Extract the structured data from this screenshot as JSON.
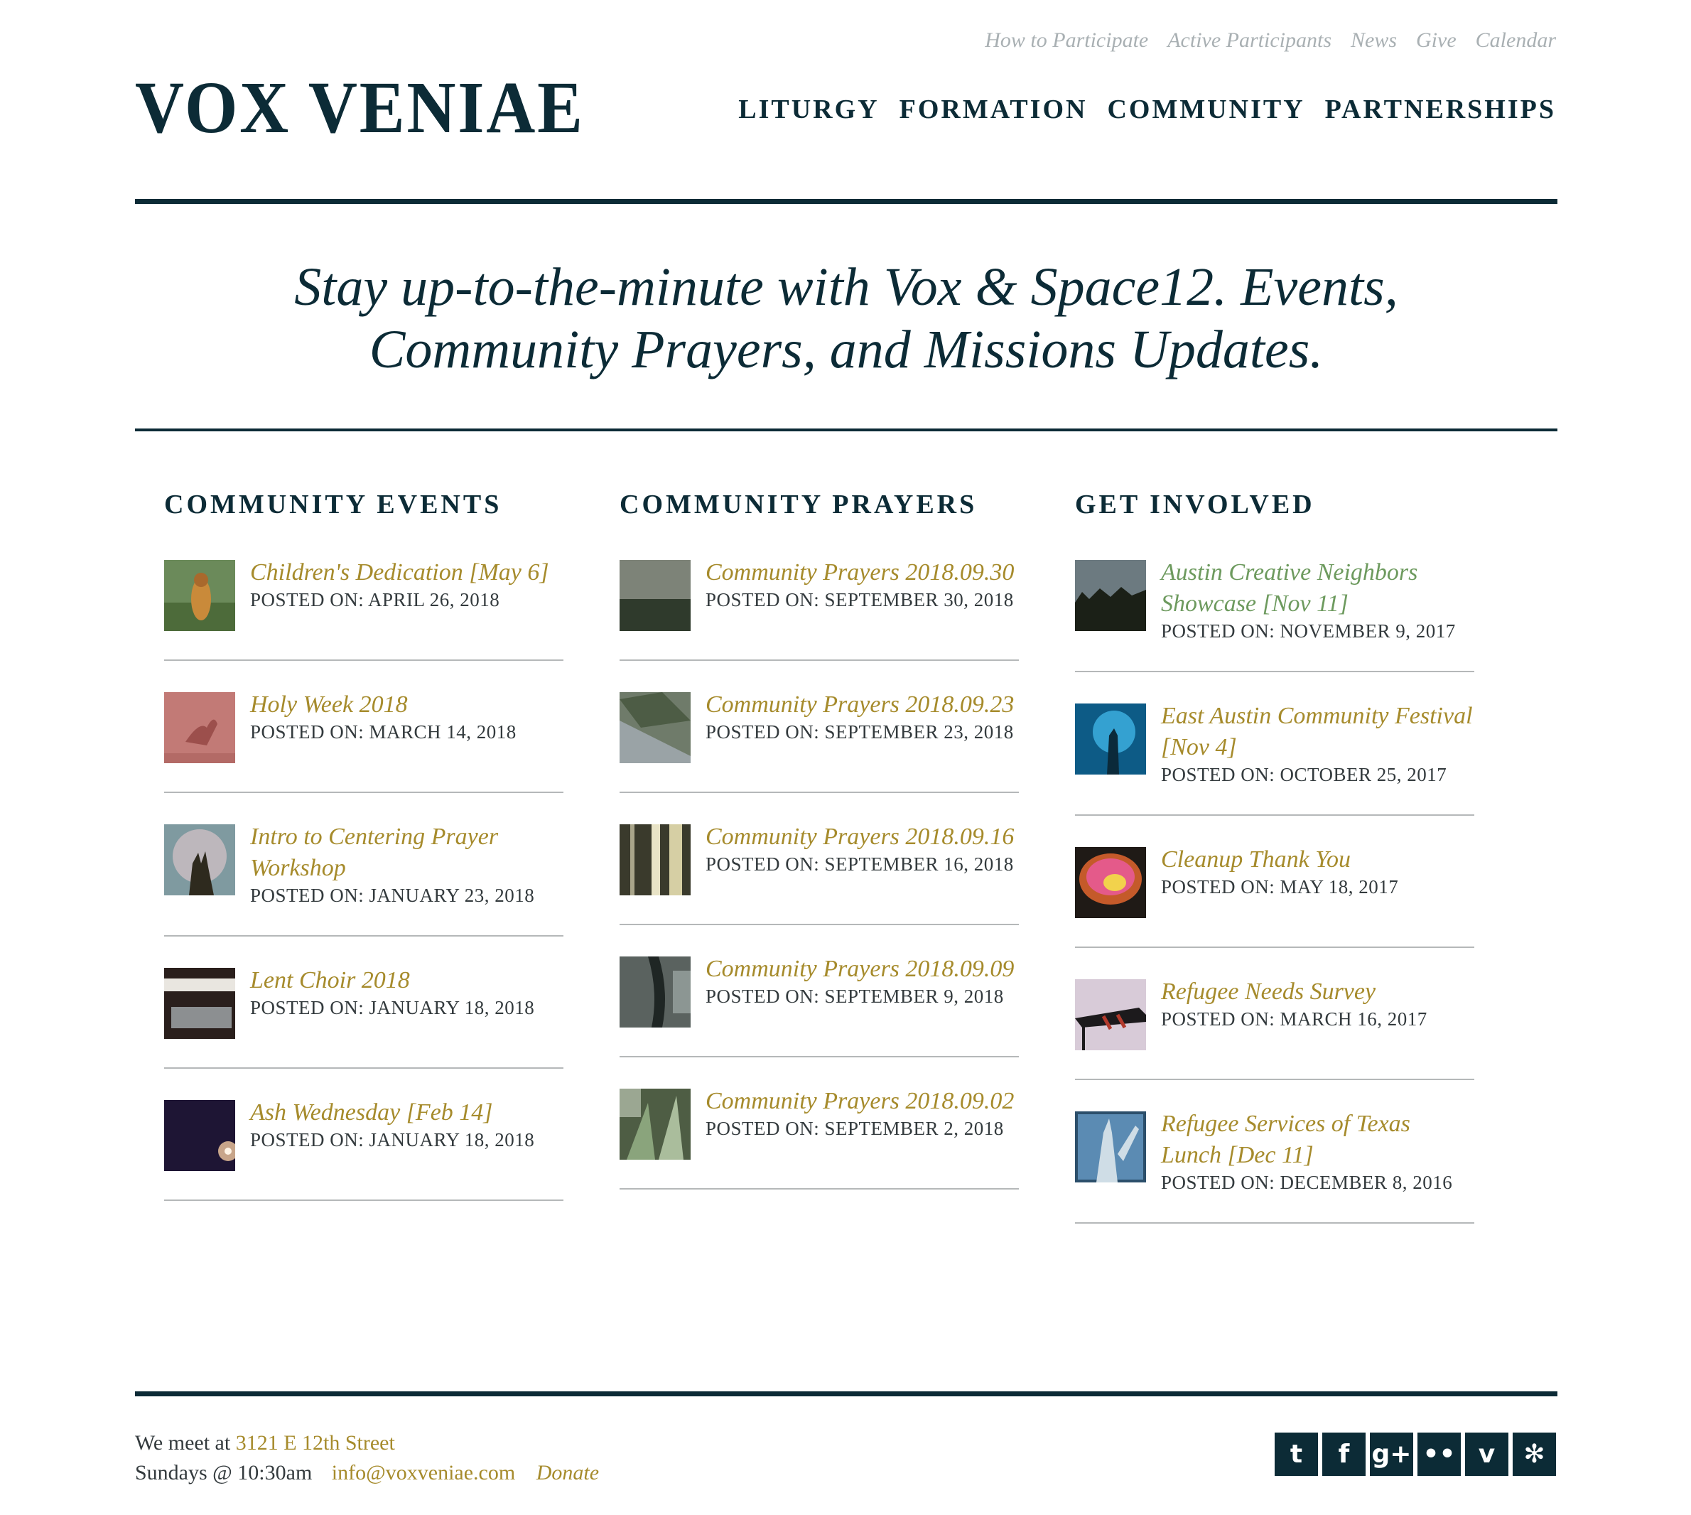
{
  "header": {
    "logo": "VOX VENIAE",
    "utility_nav": [
      "How to Participate",
      "Active Participants",
      "News",
      "Give",
      "Calendar"
    ],
    "main_nav": [
      "LITURGY",
      "FORMATION",
      "COMMUNITY",
      "PARTNERSHIPS"
    ]
  },
  "tagline": {
    "line1": "Stay up-to-the-minute with Vox & Space12. Events,",
    "line2": "Community Prayers, and Missions Updates."
  },
  "columns": [
    {
      "heading": "COMMUNITY EVENTS",
      "items": [
        {
          "title": "Children's Dedication [May 6]",
          "date": "POSTED ON: APRIL 26, 2018"
        },
        {
          "title": "Holy Week 2018",
          "date": "POSTED ON: MARCH 14, 2018"
        },
        {
          "title": "Intro to Centering Prayer Workshop",
          "date": "POSTED ON: JANUARY 23, 2018"
        },
        {
          "title": "Lent Choir 2018",
          "date": "POSTED ON: JANUARY 18, 2018"
        },
        {
          "title": "Ash Wednesday [Feb 14]",
          "date": "POSTED ON: JANUARY 18, 2018"
        }
      ]
    },
    {
      "heading": "COMMUNITY PRAYERS",
      "items": [
        {
          "title": "Community Prayers 2018.09.30",
          "date": "POSTED ON: SEPTEMBER 30, 2018"
        },
        {
          "title": "Community Prayers 2018.09.23",
          "date": "POSTED ON: SEPTEMBER 23, 2018"
        },
        {
          "title": "Community Prayers 2018.09.16",
          "date": "POSTED ON: SEPTEMBER 16, 2018"
        },
        {
          "title": "Community Prayers 2018.09.09",
          "date": "POSTED ON: SEPTEMBER 9, 2018"
        },
        {
          "title": "Community Prayers 2018.09.02",
          "date": "POSTED ON: SEPTEMBER 2, 2018"
        }
      ]
    },
    {
      "heading": "GET INVOLVED",
      "items": [
        {
          "title": "Austin Creative Neighbors Showcase [Nov 11]",
          "date": "POSTED ON: NOVEMBER 9, 2017"
        },
        {
          "title": "East Austin Community Festival [Nov 4]",
          "date": "POSTED ON: OCTOBER 25, 2017"
        },
        {
          "title": "Cleanup Thank You",
          "date": "POSTED ON: MAY 18, 2017"
        },
        {
          "title": "Refugee Needs Survey",
          "date": "POSTED ON: MARCH 16, 2017"
        },
        {
          "title": "Refugee Services of Texas Lunch [Dec 11]",
          "date": "POSTED ON: DECEMBER 8, 2016"
        }
      ]
    }
  ],
  "footer": {
    "meet_prefix": "We meet at",
    "address": "3121 E 12th Street",
    "time": "Sundays @ 10:30am",
    "email": "info@voxveniae.com",
    "donate": "Donate",
    "social": [
      {
        "icon": "twitter-icon",
        "glyph": "t"
      },
      {
        "icon": "facebook-icon",
        "glyph": "f"
      },
      {
        "icon": "google-plus-icon",
        "glyph": "g+"
      },
      {
        "icon": "flickr-icon",
        "glyph": "••"
      },
      {
        "icon": "vimeo-icon",
        "glyph": "v"
      },
      {
        "icon": "yelp-icon",
        "glyph": "✻"
      }
    ]
  },
  "colors": {
    "primary": "#0c2b36",
    "link": "#a68b2c",
    "visited_link": "#6d9a5e",
    "muted": "#a9b0b3"
  }
}
